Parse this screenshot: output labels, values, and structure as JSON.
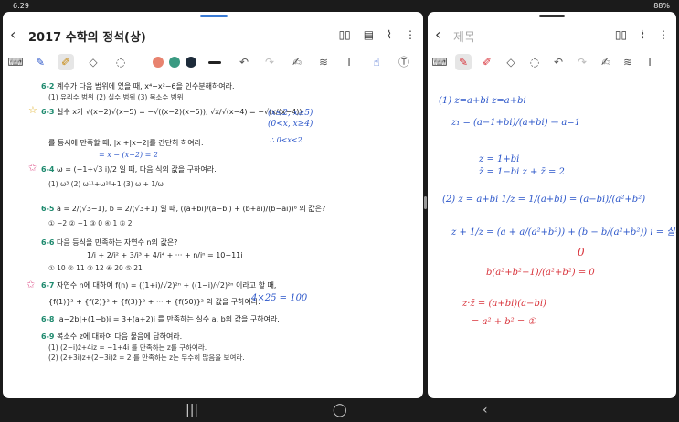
{
  "status": {
    "time": "6:29",
    "battery": "88%"
  },
  "left": {
    "title": "2017 수학의 정석(상)",
    "problems": [
      {
        "num": "6-2",
        "text": "계수가 다음 범위에 있을 때, x⁴−x²−6을 인수분해하여라.",
        "choices": "(1) 유리수 범위        (2) 실수 범위        (3) 복소수 범위"
      },
      {
        "num": "6-3",
        "text": "실수 x가  √(x−2)√(x−5) = −√((x−2)(x−5)),   √x/√(x−4) = −√(x/(x−4))",
        "text2": "를 동시에 만족할 때, |x|+|x−2|를 간단히 하여라."
      },
      {
        "num": "6-4",
        "text": "ω = (−1+√3 i)/2 일 때, 다음 식의 값을 구하여라.",
        "choices": "(1) ω³        (2) ω¹¹+ω¹⁰+1        (3) ω + 1/ω"
      },
      {
        "num": "6-5",
        "text": "a = 2/(√3−1),  b = 2/(√3+1) 일 때, ((a+bi)/(a−bi) + (b+ai)/(b−ai))⁸ 의 값은?",
        "choices": "① −2      ② −1      ③ 0      ④ 1      ⑤ 2"
      },
      {
        "num": "6-6",
        "text": "다음 등식을 만족하는 자연수 n의 값은?",
        "text2": "1/i + 2/i² + 3/i³ + 4/i⁴ + ··· + n/iⁿ = 10−11i",
        "choices": "① 10      ② 11      ③ 12      ④ 20      ⑤ 21"
      },
      {
        "num": "6-7",
        "text": "자연수 n에 대하여 f(n) = ((1+i)/√2)²ⁿ + ((1−i)/√2)²ⁿ 이라고 할 때,",
        "text2": "{f(1)}² + {f(2)}² + {f(3)}² + ··· + {f(50)}² 의 값을 구하여라."
      },
      {
        "num": "6-8",
        "text": "|a−2b|+(1−b)i = 3+(a+2)i 를 만족하는 실수 a, b의 값을 구하여라."
      },
      {
        "num": "6-9",
        "text": "복소수 z에 대하여 다음 물음에 답하여라.",
        "text2": "(1) (2−i)z̄+4iz = −1+4i 를 만족하는 z를 구하여라.",
        "text3": "(2) (2+3i)z+(2−3i)z̄ = 2 를 만족하는 z는 무수히 많음을 보여라."
      }
    ],
    "notes": {
      "side": "(x≤2, x≥5)",
      "side2": "(0<x, x≥4)",
      "cond": "∴ 0<x<2",
      "eq": "= x − (x−2) = 2",
      "ans": "4×25 = 100"
    }
  },
  "right": {
    "title_placeholder": "제목",
    "notes": [
      "(1) z=a+bi z=a+bi",
      "z₁ = (a−1+bi)/(a+bi)   →  a=1",
      "z = 1+bi",
      "z̄ = 1−bi       z + z̄ = 2",
      "(2)  z = a+bi     1/z = 1/(a+bi) = (a−bi)/(a²+b²)",
      "z + 1/z = (a + a/(a²+b²)) + (b − b/(a²+b²)) i = 실수",
      "0",
      "b(a²+b²−1)/(a²+b²) = 0",
      "z·z̄ = (a+bi)(a−bi)",
      "= a² + b² = ①"
    ]
  }
}
